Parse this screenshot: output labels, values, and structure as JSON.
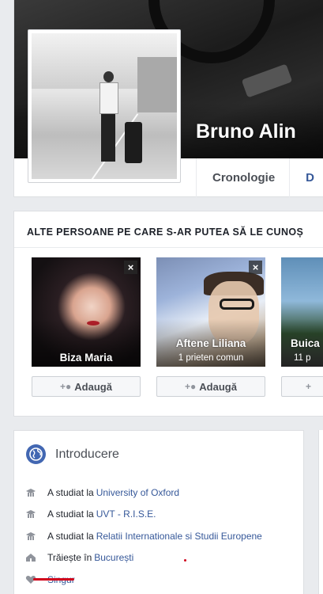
{
  "profile": {
    "name": "Bruno Alin",
    "tabs": [
      "Cronologie",
      "D"
    ]
  },
  "pymk": {
    "title": "ALTE PERSOANE PE CARE S-AR PUTEA SĂ LE CUNOȘ",
    "add_label": "Adaugă",
    "close_glyph": "×",
    "people": [
      {
        "name": "Biza Maria",
        "mutual": ""
      },
      {
        "name": "Aftene Liliana",
        "mutual": "1 prieten comun"
      },
      {
        "name": "Buica",
        "mutual": "11 p"
      }
    ]
  },
  "intro": {
    "title": "Introducere",
    "items": [
      {
        "icon": "graduation-icon",
        "text": "A studiat la",
        "link": "University of Oxford"
      },
      {
        "icon": "graduation-icon",
        "text": "A studiat la",
        "link": "UVT - R.I.S.E."
      },
      {
        "icon": "graduation-icon",
        "text": "A studiat la",
        "link": "Relatii Internationale si Studii Europene"
      },
      {
        "icon": "home-icon",
        "text": "Trăiește în",
        "link": "București"
      },
      {
        "icon": "heart-icon",
        "text": "",
        "link": "Singur"
      }
    ]
  },
  "colors": {
    "link": "#365899",
    "facebook_blue": "#4267b2",
    "annotation_red": "#d0021b"
  }
}
